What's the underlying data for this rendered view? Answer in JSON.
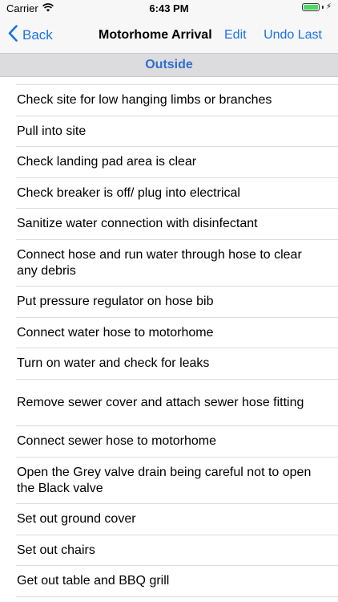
{
  "status_bar": {
    "carrier": "Carrier",
    "time": "6:43 PM",
    "wifi_icon": "wifi-icon",
    "battery_icon": "battery-icon"
  },
  "nav": {
    "back_label": "Back",
    "title": "Motorhome Arrival",
    "edit_label": "Edit",
    "undo_label": "Undo Last"
  },
  "section": {
    "title": "Outside"
  },
  "items": [
    {
      "label": "Check site for low hanging limbs or branches",
      "lines": 1
    },
    {
      "label": "Pull into site",
      "lines": 1
    },
    {
      "label": "Check landing pad area is clear",
      "lines": 1
    },
    {
      "label": "Check breaker is off/ plug into electrical",
      "lines": 1
    },
    {
      "label": "Sanitize water connection with disinfectant",
      "lines": 1
    },
    {
      "label": "Connect hose and run water through hose to clear any debris",
      "lines": 2
    },
    {
      "label": "Put pressure regulator on hose bib",
      "lines": 1
    },
    {
      "label": "Connect water hose to motorhome",
      "lines": 1
    },
    {
      "label": "Turn on water and check for leaks",
      "lines": 1
    },
    {
      "label": "Remove sewer cover and attach sewer hose fitting",
      "lines": 2
    },
    {
      "label": "Connect sewer hose to motorhome",
      "lines": 1
    },
    {
      "label": "Open the Grey valve drain being careful not to open the Black valve",
      "lines": 2
    },
    {
      "label": "Set out ground cover",
      "lines": 1
    },
    {
      "label": "Set out chairs",
      "lines": 1
    },
    {
      "label": "Get out table and BBQ grill",
      "lines": 1
    }
  ]
}
